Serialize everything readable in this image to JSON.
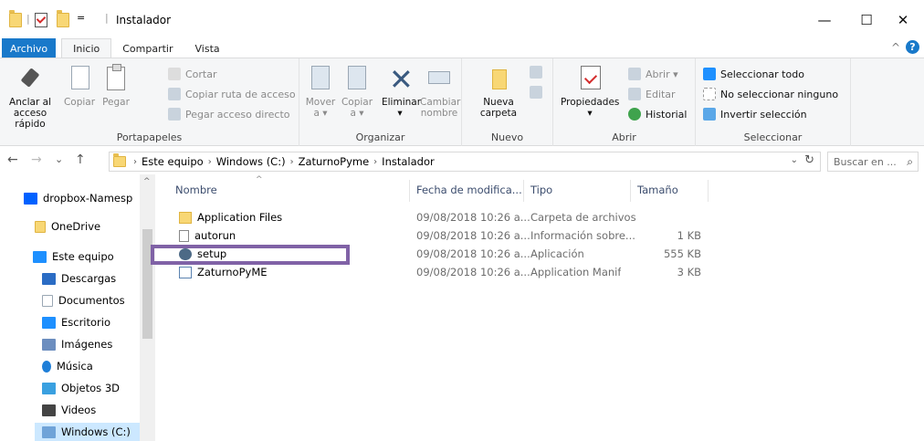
{
  "window": {
    "title": "Instalador",
    "qa_dropdown": "=",
    "qa_sep": "|",
    "minimize": "—",
    "maximize": "☐",
    "close": "✕"
  },
  "ribbon_tabs": {
    "file": "Archivo",
    "home": "Inicio",
    "share": "Compartir",
    "view": "Vista",
    "collapse": "^",
    "help": "?"
  },
  "ribbon": {
    "clipboard": {
      "label": "Portapapeles",
      "pin": "Anclar al acceso rápido",
      "copy": "Copiar",
      "paste": "Pegar",
      "cut": "Cortar",
      "copy_path": "Copiar ruta de acceso",
      "paste_shortcut": "Pegar acceso directo"
    },
    "organize": {
      "label": "Organizar",
      "move": "Mover a ▾",
      "copy_to": "Copiar a ▾",
      "delete": "Eliminar ▾",
      "rename": "Cambiar nombre"
    },
    "new": {
      "label": "Nuevo",
      "new_folder": "Nueva carpeta"
    },
    "open": {
      "label": "Abrir",
      "properties": "Propiedades ▾",
      "open": "Abrir ▾",
      "edit": "Editar",
      "history": "Historial"
    },
    "select": {
      "label": "Seleccionar",
      "select_all": "Seleccionar todo",
      "select_none": "No seleccionar ninguno",
      "invert": "Invertir selección"
    }
  },
  "nav": {
    "back": "←",
    "forward": "→",
    "recent": "⌄",
    "up": "↑",
    "breadcrumb": [
      "Este equipo",
      "Windows (C:)",
      "ZaturnoPyme",
      "Instalador"
    ],
    "sep": "›",
    "dropdown": "⌄",
    "refresh": "↻",
    "search_placeholder": "Buscar en ...",
    "search_icon": "⌕"
  },
  "sidebar": {
    "scroll_up": "^",
    "items": [
      {
        "label": "dropbox-Namesp",
        "icon": "dropbox-icon",
        "color": "#0061ff"
      },
      {
        "label": "OneDrive",
        "icon": "folder-icon",
        "color": "#f8d775"
      },
      {
        "label": "Este equipo",
        "icon": "computer-icon",
        "color": "#1e90ff"
      },
      {
        "label": "Descargas",
        "icon": "download-icon",
        "color": "#2b6cc4"
      },
      {
        "label": "Documentos",
        "icon": "document-icon",
        "color": "#9aa7b4"
      },
      {
        "label": "Escritorio",
        "icon": "desktop-icon",
        "color": "#1e90ff"
      },
      {
        "label": "Imágenes",
        "icon": "pictures-icon",
        "color": "#6c8ebf"
      },
      {
        "label": "Música",
        "icon": "music-icon",
        "color": "#1f7fd8"
      },
      {
        "label": "Objetos 3D",
        "icon": "cube-icon",
        "color": "#3aa0e0"
      },
      {
        "label": "Videos",
        "icon": "video-icon",
        "color": "#444"
      },
      {
        "label": "Windows (C:)",
        "icon": "drive-icon",
        "color": "#6fa3d8"
      }
    ]
  },
  "files": {
    "columns": {
      "name": "Nombre",
      "date": "Fecha de modifica...",
      "type": "Tipo",
      "size": "Tamaño",
      "sort": "^"
    },
    "rows": [
      {
        "name": "Application Files",
        "date": "09/08/2018 10:26 a...",
        "type": "Carpeta de archivos",
        "size": "",
        "icon": "folder-icon"
      },
      {
        "name": "autorun",
        "date": "09/08/2018 10:26 a...",
        "type": "Información sobre...",
        "size": "1 KB",
        "icon": "settings-file-icon"
      },
      {
        "name": "setup",
        "date": "09/08/2018 10:26 a...",
        "type": "Aplicación",
        "size": "555 KB",
        "icon": "setup-app-icon"
      },
      {
        "name": "ZaturnoPyME",
        "date": "09/08/2018 10:26 a...",
        "type": "Application Manif",
        "size": "3 KB",
        "icon": "manifest-icon"
      }
    ]
  },
  "colors": {
    "accent": "#1979ca",
    "highlight_box": "#8062a6",
    "selection": "#cce8ff"
  }
}
